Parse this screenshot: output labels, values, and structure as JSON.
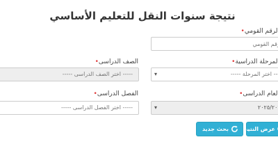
{
  "page_title": "نتيجة سنوات النقل للتعليم الأساسي",
  "form": {
    "national_id": {
      "label": "الرقم القومي",
      "placeholder": "الرقم القومي"
    },
    "stage": {
      "label": "المرحلة الدراسية",
      "value": "----- اختر المرحلة -----"
    },
    "grade": {
      "label": "الصف الدراسى",
      "value": "----- اختر الصف الدراسى -----"
    },
    "year": {
      "label": "العام الدراسى",
      "value": "٢٠٢٥/٢٠٢٤"
    },
    "term": {
      "label": "الفصل الدراسى",
      "value": "----- اختر الفصل الدراسى -----"
    }
  },
  "buttons": {
    "search_label": "عرض النتيجة",
    "new_search_label": "بحث جديد"
  },
  "colors": {
    "required_marker": "#e03a3a",
    "button_bg": "#31b0d5"
  },
  "icons": {
    "search": "search-icon",
    "refresh": "refresh-icon"
  }
}
